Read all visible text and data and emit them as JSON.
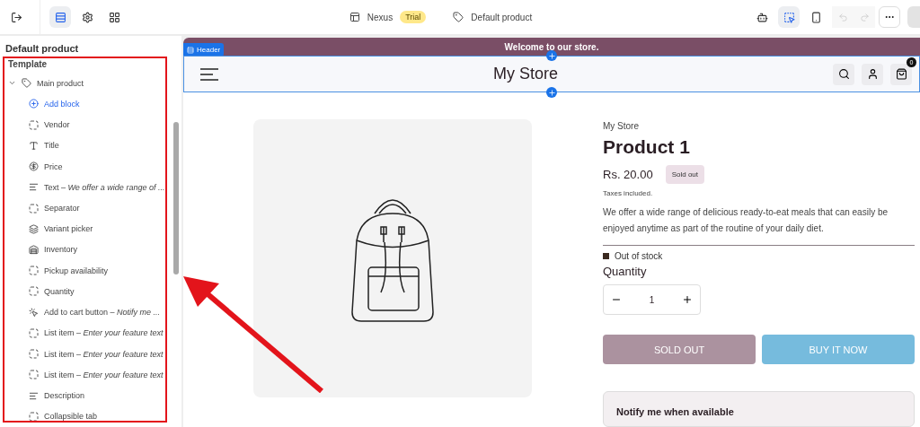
{
  "topbar": {
    "left_tools": [
      {
        "selected": false
      },
      {
        "selected": true
      },
      {
        "selected": false
      },
      {
        "selected": false
      }
    ],
    "theme_name": "Nexus",
    "theme_badge": "Trial",
    "template_name": "Default product",
    "right_tools": [
      {
        "selected": false
      },
      {
        "selected": true
      },
      {
        "selected": false
      }
    ],
    "history": [
      {
        "disabled": true
      },
      {
        "disabled": true
      }
    ]
  },
  "sidebar": {
    "title": "Default product",
    "section": "Template",
    "group": {
      "label": "Main product",
      "expanded": true,
      "children": [
        {
          "kind": "add",
          "label": "Add block"
        },
        {
          "kind": "block",
          "label": "Vendor"
        },
        {
          "kind": "title",
          "label": "Title"
        },
        {
          "kind": "price",
          "label": "Price"
        },
        {
          "kind": "text",
          "label": "Text – *We offer a wide range of ...*"
        },
        {
          "kind": "block",
          "label": "Separator"
        },
        {
          "kind": "variant",
          "label": "Variant picker"
        },
        {
          "kind": "inventory",
          "label": "Inventory"
        },
        {
          "kind": "block",
          "label": "Pickup availability"
        },
        {
          "kind": "block",
          "label": "Quantity"
        },
        {
          "kind": "button",
          "label": "Add to cart button – *Notify me ...*"
        },
        {
          "kind": "block",
          "label": "List item – *Enter your feature text*"
        },
        {
          "kind": "block",
          "label": "List item – *Enter your feature text*"
        },
        {
          "kind": "block",
          "label": "List item – *Enter your feature text*"
        },
        {
          "kind": "text",
          "label": "Description"
        },
        {
          "kind": "block",
          "label": "Collapsible tab"
        }
      ]
    }
  },
  "preview": {
    "section_tag": "Header",
    "announcement": "Welcome to our store.",
    "logo": "My Store",
    "cart_count": "0",
    "product": {
      "vendor": "My Store",
      "title": "Product 1",
      "price": "Rs. 20.00",
      "badge": "Sold out",
      "tax_note": "Taxes included.",
      "description": "We offer a wide range of delicious ready-to-eat meals that can easily be enjoyed anytime as part of the routine of your daily diet.",
      "stock": "Out of stock",
      "quantity_label": "Quantity",
      "quantity": "1",
      "buttons": [
        {
          "label": "SOLD OUT",
          "disabled": true
        },
        {
          "label": "BUY IT NOW",
          "disabled": false
        }
      ],
      "notify_title": "Notify me when available"
    }
  }
}
